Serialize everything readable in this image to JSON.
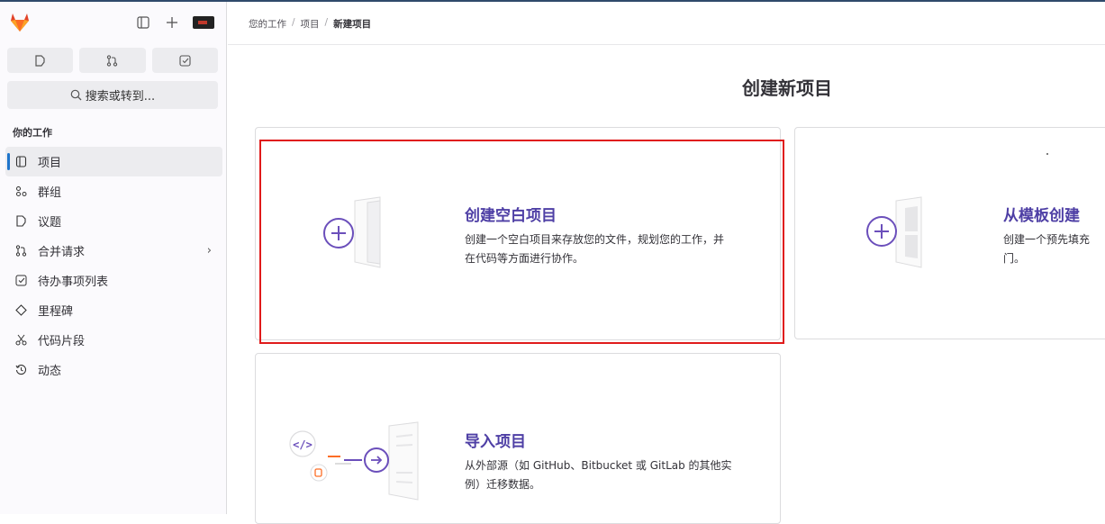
{
  "colors": {
    "accent": "#4e3fa5",
    "nav_active_bar": "#1f75cb",
    "highlight": "#e01b1b"
  },
  "sidebar": {
    "logo": "gitlab-tanuki-icon",
    "search_label": "搜索或转到...",
    "section_title": "你的工作",
    "items": [
      {
        "label": "项目",
        "icon": "project-icon"
      },
      {
        "label": "群组",
        "icon": "group-icon"
      },
      {
        "label": "议题",
        "icon": "issue-icon"
      },
      {
        "label": "合并请求",
        "icon": "merge-request-icon"
      },
      {
        "label": "待办事项列表",
        "icon": "todo-icon"
      },
      {
        "label": "里程碑",
        "icon": "milestone-icon"
      },
      {
        "label": "代码片段",
        "icon": "snippet-icon"
      },
      {
        "label": "动态",
        "icon": "activity-icon"
      }
    ]
  },
  "breadcrumb": {
    "item1": "您的工作",
    "item2": "项目",
    "current": "新建项目"
  },
  "page": {
    "title": "创建新项目"
  },
  "cards": {
    "blank": {
      "title": "创建空白项目",
      "desc_line1": "创建一个空白项目来存放您的文件，规划您的工作，并",
      "desc_line2": "在代码等方面进行协作。"
    },
    "template": {
      "title": "从模板创建",
      "desc_line1": "创建一个预先填充",
      "desc_line2": "门。"
    },
    "import": {
      "title": "导入项目",
      "desc_line1": "从外部源（如 GitHub、Bitbucket 或 GitLab 的其他实",
      "desc_line2": "例）迁移数据。"
    }
  }
}
